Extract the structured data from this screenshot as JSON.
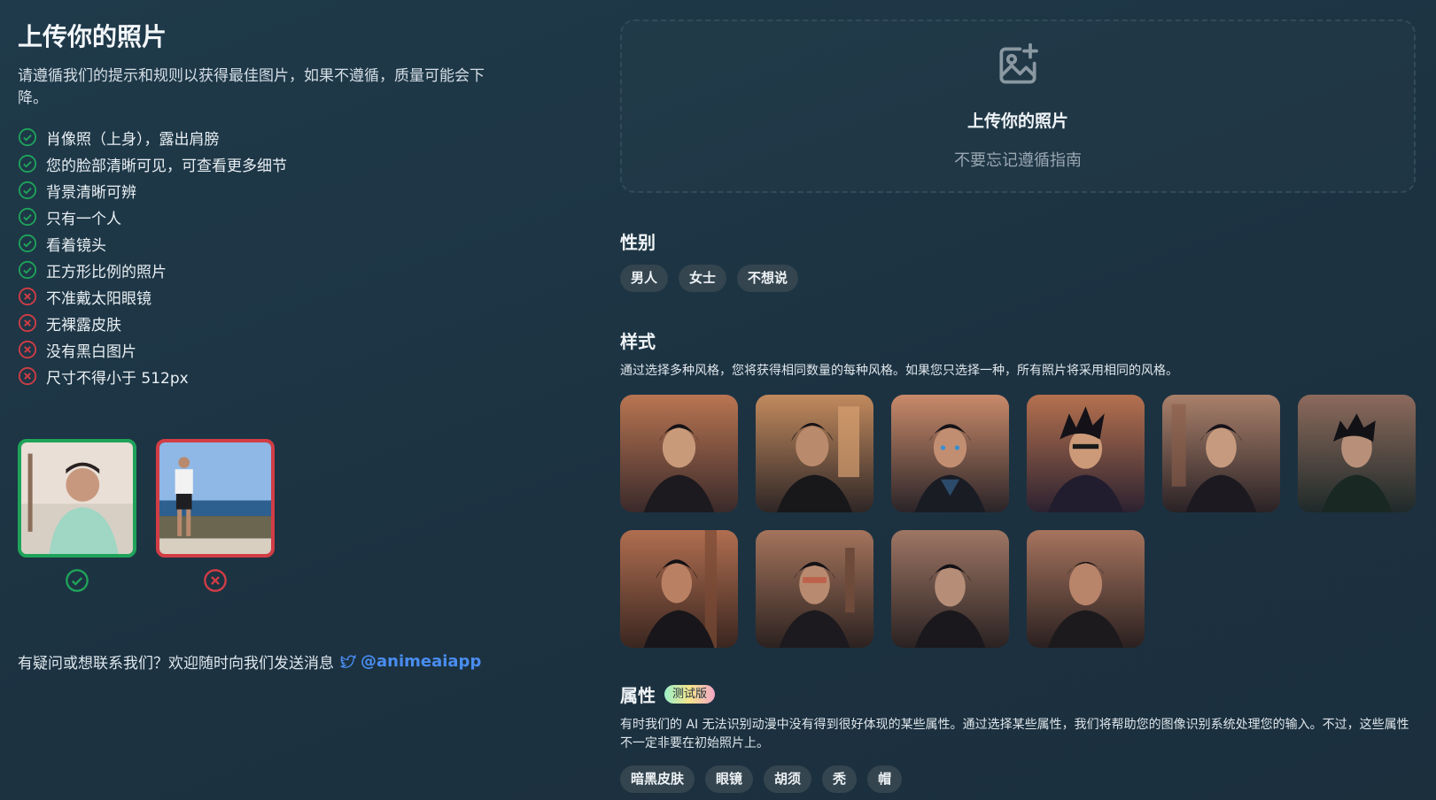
{
  "guide": {
    "title": "上传你的照片",
    "intro": "请遵循我们的提示和规则以获得最佳图片，如果不遵循，质量可能会下降。",
    "rules": [
      {
        "text": "肖像照（上身），露出肩膀",
        "ok": true
      },
      {
        "text": "您的脸部清晰可见，可查看更多细节",
        "ok": true
      },
      {
        "text": "背景清晰可辨",
        "ok": true
      },
      {
        "text": "只有一个人",
        "ok": true
      },
      {
        "text": "看着镜头",
        "ok": true
      },
      {
        "text": "正方形比例的照片",
        "ok": true
      },
      {
        "text": "不准戴太阳眼镜",
        "ok": false
      },
      {
        "text": "无裸露皮肤",
        "ok": false
      },
      {
        "text": "没有黑白图片",
        "ok": false
      },
      {
        "text": "尺寸不得小于 512px",
        "ok": false
      }
    ]
  },
  "contact": {
    "text": "有疑问或想联系我们？欢迎随时向我们发送消息",
    "handle": "@animeaiapp"
  },
  "upload": {
    "title": "上传你的照片",
    "subtitle": "不要忘记遵循指南"
  },
  "gender": {
    "title": "性别",
    "options": [
      "男人",
      "女士",
      "不想说"
    ]
  },
  "styles": {
    "title": "样式",
    "description": "通过选择多种风格，您将获得相同数量的每种风格。如果您只选择一种，所有照片将采用相同的风格。"
  },
  "attributes": {
    "title": "属性",
    "badge": "测试版",
    "description": "有时我们的 AI 无法识别动漫中没有得到很好体现的某些属性。通过选择某些属性，我们将帮助您的图像识别系统处理您的输入。不过，这些属性不一定非要在初始照片上。",
    "options": [
      "暗黑皮肤",
      "眼镜",
      "胡须",
      "秃",
      "帽"
    ]
  },
  "colors": {
    "accent": "#4a8df0",
    "good": "#1fa35a",
    "bad": "#d23d45"
  }
}
